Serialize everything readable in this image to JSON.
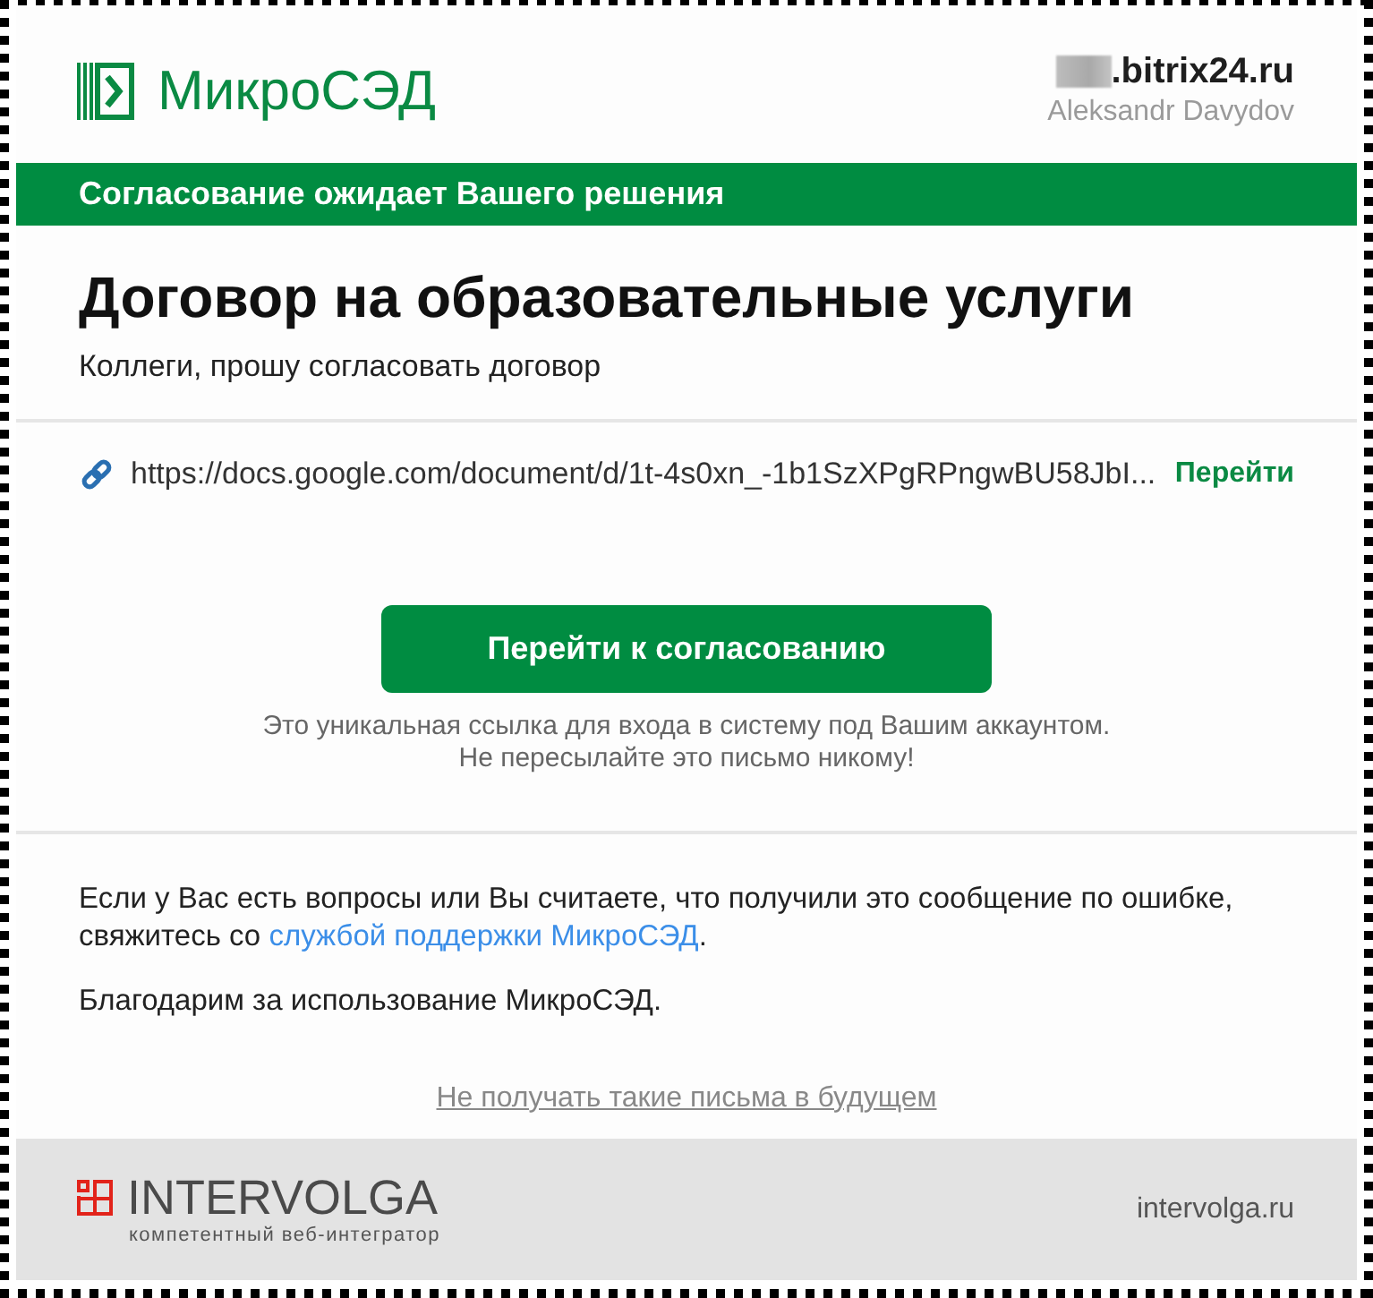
{
  "header": {
    "logo": "МикроСЭД",
    "portal": ".bitrix24.ru",
    "user": "Aleksandr Davydov"
  },
  "status_banner": "Согласование ожидает Вашего решения",
  "document": {
    "title": "Договор на образовательные услуги",
    "message": "Коллеги, прошу согласовать договор"
  },
  "link": {
    "url": "https://docs.google.com/document/d/1t-4s0xn_-1b1SzXPgRPngwBU58JbI...",
    "action": "Перейти"
  },
  "approve_button": "Перейти к согласованию",
  "notice": [
    "Это уникальная ссылка для входа в систему под Вашим аккаунтом.",
    "Не пересылайте это письмо никому!"
  ],
  "support": {
    "text": "Если у Вас есть вопросы или Вы считаете, что получили это сообщение по ошибке, свяжитесь со",
    "link": "службой поддержки МикроСЭД",
    "end": "."
  },
  "thanks": "Благодарим за использование МикроСЭД.",
  "unsubscribe": "Не получать такие письма в будущем",
  "footer": {
    "brand": "INTERVOLGA",
    "tagline": "компетентный веб-интегратор",
    "site": "intervolga.ru"
  }
}
